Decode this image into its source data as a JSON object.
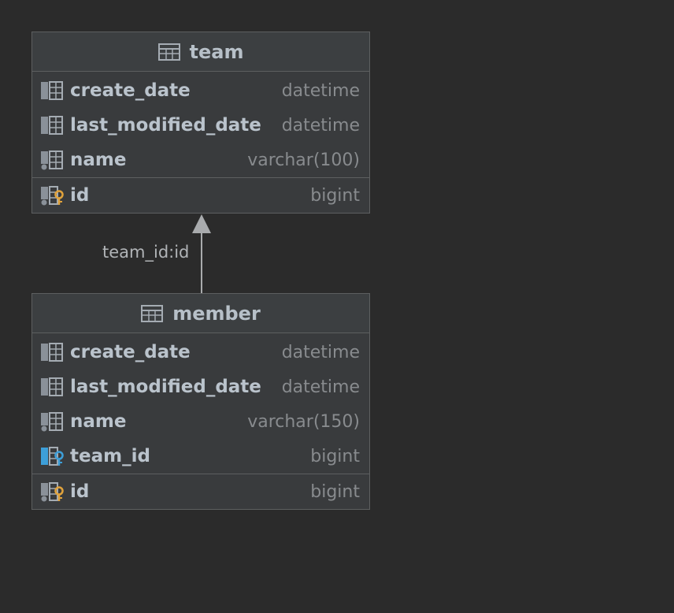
{
  "tables": {
    "team": {
      "title": "team",
      "columns": [
        {
          "name": "create_date",
          "type": "datetime",
          "icon": "column-icon"
        },
        {
          "name": "last_modified_date",
          "type": "datetime",
          "icon": "column-icon"
        },
        {
          "name": "name",
          "type": "varchar(100)",
          "icon": "column-not-null-icon"
        }
      ],
      "primary_key": {
        "name": "id",
        "type": "bigint",
        "icon": "primary-key-icon"
      }
    },
    "member": {
      "title": "member",
      "columns": [
        {
          "name": "create_date",
          "type": "datetime",
          "icon": "column-icon"
        },
        {
          "name": "last_modified_date",
          "type": "datetime",
          "icon": "column-icon"
        },
        {
          "name": "name",
          "type": "varchar(150)",
          "icon": "column-not-null-icon"
        },
        {
          "name": "team_id",
          "type": "bigint",
          "icon": "foreign-key-icon"
        }
      ],
      "primary_key": {
        "name": "id",
        "type": "bigint",
        "icon": "primary-key-icon"
      }
    }
  },
  "relationship": {
    "label": "team_id:id"
  },
  "colors": {
    "background": "#2b2b2b",
    "table_body": "#393b3d",
    "border": "#5d5f60",
    "primary_key": "#e1a33c",
    "foreign_key": "#3d9fd9"
  }
}
